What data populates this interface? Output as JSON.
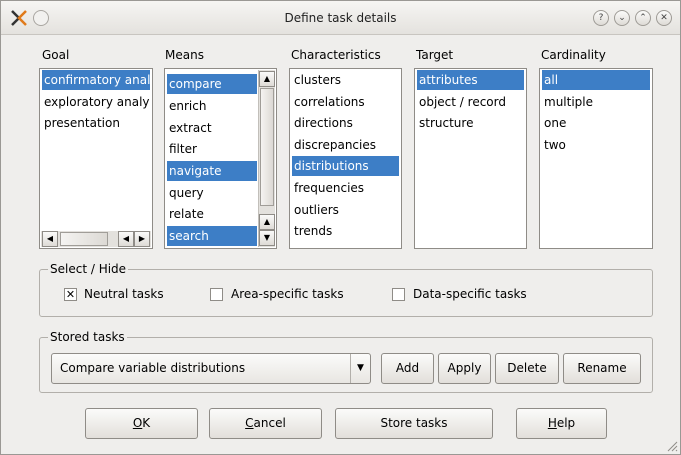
{
  "window": {
    "title": "Define task details"
  },
  "columns": {
    "goal": {
      "header": "Goal",
      "items": [
        "confirmatory anal",
        "exploratory analy",
        "presentation"
      ]
    },
    "means": {
      "header": "Means",
      "items": [
        "compare",
        "enrich",
        "extract",
        "filter",
        "navigate",
        "query",
        "relate",
        "search"
      ]
    },
    "characteristics": {
      "header": "Characteristics",
      "items": [
        "clusters",
        "correlations",
        "directions",
        "discrepancies",
        "distributions",
        "frequencies",
        "outliers",
        "trends"
      ]
    },
    "target": {
      "header": "Target",
      "items": [
        "attributes",
        "object / record",
        "structure"
      ]
    },
    "cardinality": {
      "header": "Cardinality",
      "items": [
        "all",
        "multiple",
        "one",
        "two"
      ]
    }
  },
  "select_hide": {
    "legend": "Select / Hide",
    "neutral": {
      "label": "Neutral tasks",
      "mark": "✕"
    },
    "area": {
      "label": "Area-specific tasks"
    },
    "data": {
      "label": "Data-specific tasks"
    }
  },
  "stored": {
    "legend": "Stored tasks",
    "combo_value": "Compare variable distributions",
    "add": "Add",
    "apply": "Apply",
    "delete": "Delete",
    "rename": "Rename"
  },
  "buttons": {
    "ok_mnemonic": "O",
    "ok_rest": "K",
    "cancel_mnemonic": "C",
    "cancel_rest": "ancel",
    "store": "Store tasks",
    "help_mnemonic": "H",
    "help_rest": "elp"
  }
}
